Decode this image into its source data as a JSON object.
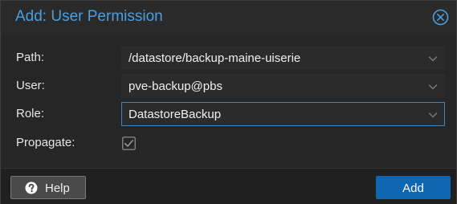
{
  "dialog": {
    "title": "Add: User Permission",
    "close_icon": "close-circle-icon"
  },
  "form": {
    "path": {
      "label": "Path:",
      "value": "/datastore/backup-maine-uiserie"
    },
    "user": {
      "label": "User:",
      "value": "pve-backup@pbs"
    },
    "role": {
      "label": "Role:",
      "value": "DatastoreBackup"
    },
    "propagate": {
      "label": "Propagate:",
      "checked": true
    }
  },
  "footer": {
    "help_label": "Help",
    "help_icon": "question-circle-icon",
    "add_label": "Add"
  },
  "colors": {
    "title": "#4a9fe0",
    "primary_button": "#0f66b1",
    "focus_border": "#3c86c4"
  }
}
